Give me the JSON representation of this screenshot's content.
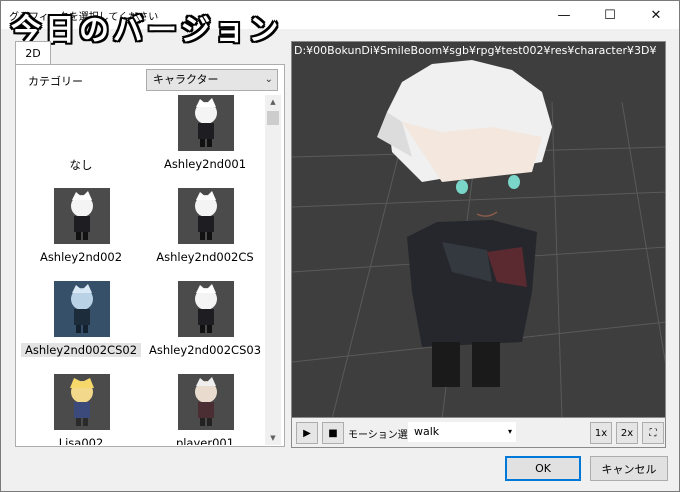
{
  "window": {
    "title": "グラフィックを選択してください",
    "banner": "今日のバージョン",
    "close_glyph": "✕",
    "max_glyph": "☐",
    "min_glyph": "—"
  },
  "tab": {
    "label": "2D"
  },
  "category": {
    "label": "カテゴリー",
    "selected": "キャラクター"
  },
  "items": [
    {
      "label": "なし",
      "has_thumb": false,
      "selected": false
    },
    {
      "label": "Ashley2nd001",
      "has_thumb": true,
      "selected": false
    },
    {
      "label": "Ashley2nd002",
      "has_thumb": true,
      "selected": false
    },
    {
      "label": "Ashley2nd002CS",
      "has_thumb": true,
      "selected": false
    },
    {
      "label": "Ashley2nd002CS02",
      "has_thumb": true,
      "selected": true
    },
    {
      "label": "Ashley2nd002CS03",
      "has_thumb": true,
      "selected": false
    },
    {
      "label": "Lisa002",
      "has_thumb": true,
      "selected": false
    },
    {
      "label": "player001",
      "has_thumb": true,
      "selected": false
    }
  ],
  "viewer": {
    "path": "D:¥00BokunDi¥SmileBoom¥sgb¥rpg¥test002¥res¥character¥3D¥"
  },
  "controls": {
    "play_glyph": "▶",
    "stop_glyph": "■",
    "motion_label": "モーション選択",
    "motion_value": "walk",
    "speed1": "1x",
    "speed2": "2x",
    "fullscreen_glyph": "⛶"
  },
  "buttons": {
    "ok": "OK",
    "cancel": "キャンセル"
  },
  "colors": {
    "accent": "#0078d7",
    "viewer_bg": "#3e3e3e",
    "selected_thumb": "#36506a"
  }
}
